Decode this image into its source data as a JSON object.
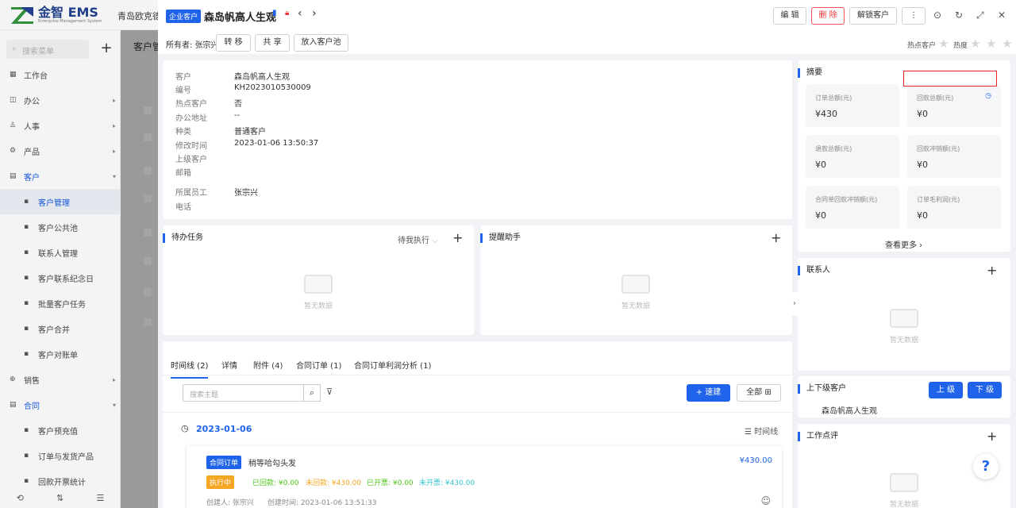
{
  "app": {
    "brand": "金智 EMS",
    "brand_sub": "Enterprise Management System",
    "company": "青岛欧克德",
    "search_placeholder": "搜索菜单",
    "plus": "+"
  },
  "nav": [
    {
      "label": "工作台",
      "icon": "▦",
      "arrow": ""
    },
    {
      "label": "办公",
      "icon": "◫",
      "arrow": "▸"
    },
    {
      "label": "人事",
      "icon": "♙",
      "arrow": "▸"
    },
    {
      "label": "产品",
      "icon": "⚙",
      "arrow": "▸"
    },
    {
      "label": "客户",
      "icon": "▤",
      "arrow": "▾"
    },
    {
      "label": "客户管理",
      "icon": "▪",
      "arrow": "",
      "sub": true
    },
    {
      "label": "客户公共池",
      "icon": "▪",
      "arrow": "",
      "sub": true
    },
    {
      "label": "联系人管理",
      "icon": "▪",
      "arrow": "",
      "sub": true
    },
    {
      "label": "客户联系纪念日",
      "icon": "▪",
      "arrow": "",
      "sub": true
    },
    {
      "label": "批量客户任务",
      "icon": "▪",
      "arrow": "",
      "sub": true
    },
    {
      "label": "客户合并",
      "icon": "▪",
      "arrow": "",
      "sub": true
    },
    {
      "label": "客户对账单",
      "icon": "▪",
      "arrow": "",
      "sub": true
    },
    {
      "label": "销售",
      "icon": "⊕",
      "arrow": "▸"
    },
    {
      "label": "合同",
      "icon": "▤",
      "arrow": "▾"
    },
    {
      "label": "客户预充值",
      "icon": "▪",
      "arrow": "",
      "sub": true
    },
    {
      "label": "订单与发货产品",
      "icon": "▪",
      "arrow": "",
      "sub": true
    },
    {
      "label": "回款开票统计",
      "icon": "▪",
      "arrow": "",
      "sub": true
    }
  ],
  "side_bottom": [
    "⟲",
    "⇅",
    "☰"
  ],
  "background": {
    "title": "客户管",
    "sub_button": "自定"
  },
  "header": {
    "tag": "企业客户",
    "name": "森岛帆高人生观",
    "prev": "‹",
    "next": "›",
    "edit": "编 辑",
    "delete": "删 除",
    "unlock": "解锁客户",
    "more": "⋮",
    "owner_label": "所有者:",
    "owner": "张宗兴",
    "transfer": "转 移",
    "share": "共 享",
    "to_pool": "放入客户池",
    "hot_customer": "热点客户",
    "heat": "热度",
    "win_icons": [
      "⊙",
      "↻",
      "⤢",
      "✕"
    ]
  },
  "info": [
    {
      "k": "客户",
      "v": "森岛帆高人生观"
    },
    {
      "k": "编号",
      "v": "KH2023010530009"
    },
    {
      "k": "热点客户",
      "v": "否"
    },
    {
      "k": "办公地址",
      "v": "--"
    },
    {
      "k": "种类",
      "v": "普通客户"
    },
    {
      "k": "修改时间",
      "v": "2023-01-06 13:50:37"
    },
    {
      "k": "上级客户",
      "v": ""
    },
    {
      "k": "邮箱",
      "v": ""
    },
    {
      "k": "所属员工",
      "v": "张宗兴"
    },
    {
      "k": "电话",
      "v": ""
    }
  ],
  "todo": {
    "title": "待办任务",
    "filter": "待我执行",
    "empty": "暂无数据"
  },
  "remind": {
    "title": "提醒助手",
    "empty": "暂无数据"
  },
  "tabs": [
    "时间线 (2)",
    "详情",
    "附件 (4)",
    "合同订单 (1)",
    "合同订单利润分析 (1)"
  ],
  "timeline": {
    "search_placeholder": "搜索主题",
    "quick": "速建",
    "all": "全部",
    "date": "2023-01-06",
    "view": "时间线",
    "entry": {
      "type": "合同订单",
      "title": "稍等哈勾头发",
      "amount": "¥430.00",
      "status": "执行中",
      "paid": "已回款: ¥0.00",
      "unpaid": "未回款: ¥430.00",
      "invoiced": "已开票: ¥0.00",
      "uninvoiced": "未开票: ¥430.00",
      "creator": "创建人: 张宗兴",
      "created": "创建时间: 2023-01-06 13:51:33"
    }
  },
  "summary": {
    "title": "摘要",
    "more": "查看更多",
    "tiles": [
      {
        "l": "订单总额(元)",
        "v": "¥430"
      },
      {
        "l": "回款总额(元)",
        "v": "¥0"
      },
      {
        "l": "退款总额(元)",
        "v": "¥0"
      },
      {
        "l": "回款冲销额(元)",
        "v": "¥0"
      },
      {
        "l": "合同单回款冲销额(元)",
        "v": "¥0"
      },
      {
        "l": "订单毛利润(元)",
        "v": "¥0"
      }
    ]
  },
  "contacts": {
    "title": "联系人",
    "empty": "暂无数据"
  },
  "hierarchy": {
    "title": "上下级客户",
    "up": "上 级",
    "down": "下 级",
    "item": "森岛帆高人生观"
  },
  "review": {
    "title": "工作点评",
    "empty": "暂无数据"
  },
  "colors": {
    "primary": "#1e63e9",
    "danger": "#e33",
    "warning": "#f5a623",
    "success": "#52c41a",
    "cyan": "#36c6d3"
  }
}
